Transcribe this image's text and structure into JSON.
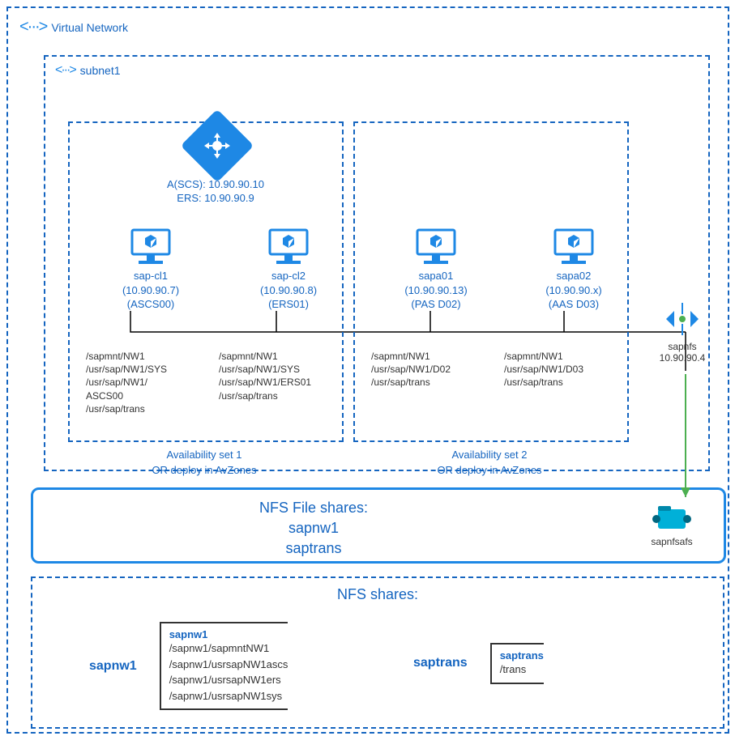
{
  "vnet": {
    "label": "Virtual Network"
  },
  "subnet": {
    "label": "subnet1"
  },
  "loadBalancer": {
    "ascs": "A(SCS): 10.90.90.10",
    "ers": "ERS: 10.90.90.9"
  },
  "vm": {
    "cl1": {
      "name": "sap-cl1",
      "ip": "(10.90.90.7)",
      "role": "(ASCS00)"
    },
    "cl2": {
      "name": "sap-cl2",
      "ip": "(10.90.90.8)",
      "role": "(ERS01)"
    },
    "a01": {
      "name": "sapa01",
      "ip": "(10.90.90.13)",
      "role": "(PAS D02)"
    },
    "a02": {
      "name": "sapa02",
      "ip": "(10.90.90.x)",
      "role": "(AAS D03)"
    }
  },
  "paths": {
    "cl1": [
      "/sapmnt/NW1",
      "/usr/sap/NW1/SYS",
      "/usr/sap/NW1/",
      "ASCS00",
      "/usr/sap/trans"
    ],
    "cl2": [
      "/sapmnt/NW1",
      "/usr/sap/NW1/SYS",
      "/usr/sap/NW1/ERS01",
      "/usr/sap/trans"
    ],
    "a01": [
      "/sapmnt/NW1",
      "/usr/sap/NW1/D02",
      "/usr/sap/trans"
    ],
    "a02": [
      "/sapmnt/NW1",
      "/usr/sap/NW1/D03",
      "/usr/sap/trans"
    ]
  },
  "avset": {
    "one": {
      "l1": "Availability set 1",
      "l2": "OR deploy in AvZones"
    },
    "two": {
      "l1": "Availability set 2",
      "l2": "OR deploy in AvZones"
    }
  },
  "privateEndpoint": {
    "name": "sapnfs",
    "ip": "10.90.90.4"
  },
  "nfs": {
    "title": "NFS File shares:",
    "share1": "sapnw1",
    "share2": "saptrans",
    "storage": "sapnfsafs"
  },
  "shares": {
    "title": "NFS shares:",
    "sapnw1": {
      "name": "sapnw1",
      "head": "sapnw1",
      "lines": [
        "/sapnw1/sapmntNW1",
        "/sapnw1/usrsapNW1ascs",
        "/sapnw1/usrsapNW1ers",
        "/sapnw1/usrsapNW1sys"
      ]
    },
    "saptrans": {
      "name": "saptrans",
      "head": "saptrans",
      "lines": [
        "/trans"
      ]
    }
  }
}
